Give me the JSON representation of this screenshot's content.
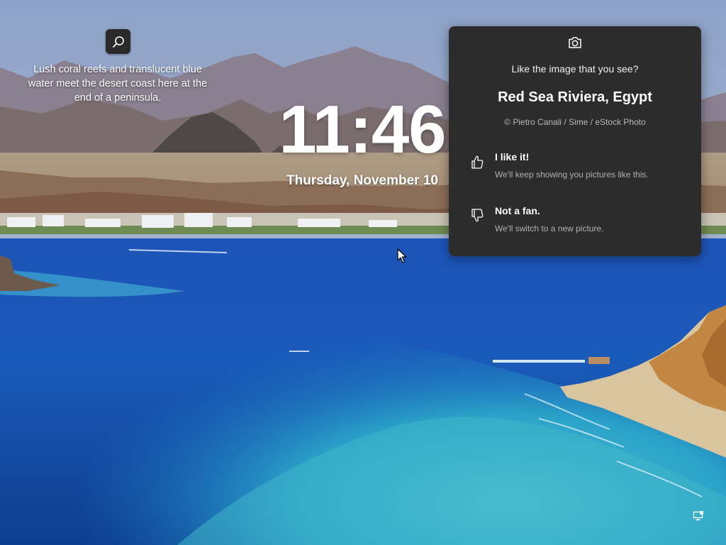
{
  "spotlight": {
    "caption": "Lush coral reefs and translucent blue water meet the desert coast here at the end of a peninsula.",
    "search_icon": "search-icon"
  },
  "clock": {
    "time": "11:46",
    "date": "Thursday, November 10"
  },
  "panel": {
    "icon": "camera-icon",
    "question": "Like the image that you see?",
    "place": "Red Sea Riviera, Egypt",
    "credit": "© Pietro Canali / Sime / eStock Photo",
    "options": [
      {
        "icon": "thumbs-up-icon",
        "title": "I like it!",
        "subtitle": "We'll keep showing you pictures like this."
      },
      {
        "icon": "thumbs-down-icon",
        "title": "Not a fan.",
        "subtitle": "We'll switch to a new picture."
      }
    ]
  },
  "system": {
    "network_icon": "network-icon"
  }
}
